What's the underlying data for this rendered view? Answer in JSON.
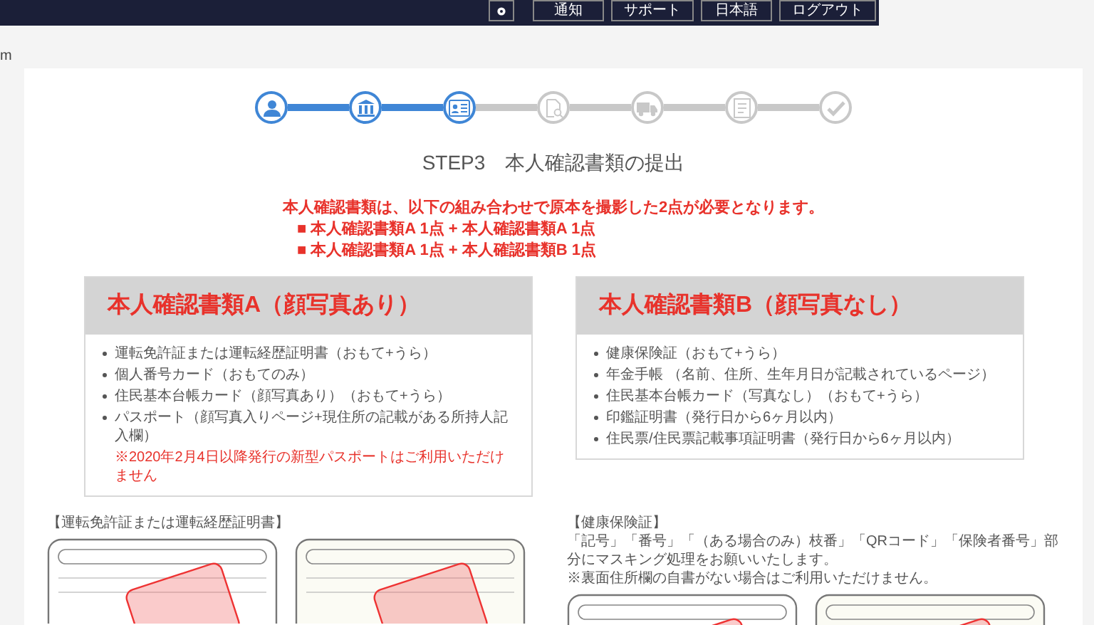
{
  "nav": {
    "buttons": [
      "通知",
      "サポート",
      "日本語",
      "ログアウト"
    ]
  },
  "side_text": "m",
  "steps": [
    {
      "completed": true
    },
    {
      "completed": true
    },
    {
      "completed": true
    },
    {
      "completed": false
    },
    {
      "completed": false
    },
    {
      "completed": false
    },
    {
      "completed": false
    }
  ],
  "title": "STEP3　本人確認書類の提出",
  "notice": {
    "lead": "本人確認書類は、以下の組み合わせで原本を撮影した2点が必要となります。",
    "options": [
      "■ 本人確認書類A 1点 + 本人確認書類A 1点",
      "■ 本人確認書類A 1点 + 本人確認書類B 1点"
    ]
  },
  "cards": [
    {
      "heading": "本人確認書類A（顔写真あり）",
      "items": [
        "運転免許証または運転経歴証明書（おもて+うら）",
        "個人番号カード（おもてのみ）",
        "住民基本台帳カード（顔写真あり）（おもて+うら）",
        "パスポート（顔写真入りページ+現住所の記載がある所持人記入欄）"
      ],
      "note": "※2020年2月4日以降発行の新型パスポートはご利用いただけません"
    },
    {
      "heading": "本人確認書類B（顔写真なし）",
      "items": [
        "健康保険証（おもて+うら）",
        "年金手帳 （名前、住所、生年月日が記載されているページ）",
        "住民基本台帳カード（写真なし）（おもて+うら）",
        "印鑑証明書（発行日から6ヶ月以内）",
        "住民票/住民票記載事項証明書（発行日から6ヶ月以内）"
      ]
    }
  ],
  "examples": [
    {
      "label": "【運転免許証または運転経歴証明書】"
    },
    {
      "label": "【健康保険証】",
      "paragraphs": [
        "「記号」「番号」「（ある場合のみ）枝番」「QRコード」「保険者番号」部分にマスキング処理をお願いいたします。",
        "※裏面住所欄の自書がない場合はご利用いただけません。"
      ]
    }
  ]
}
